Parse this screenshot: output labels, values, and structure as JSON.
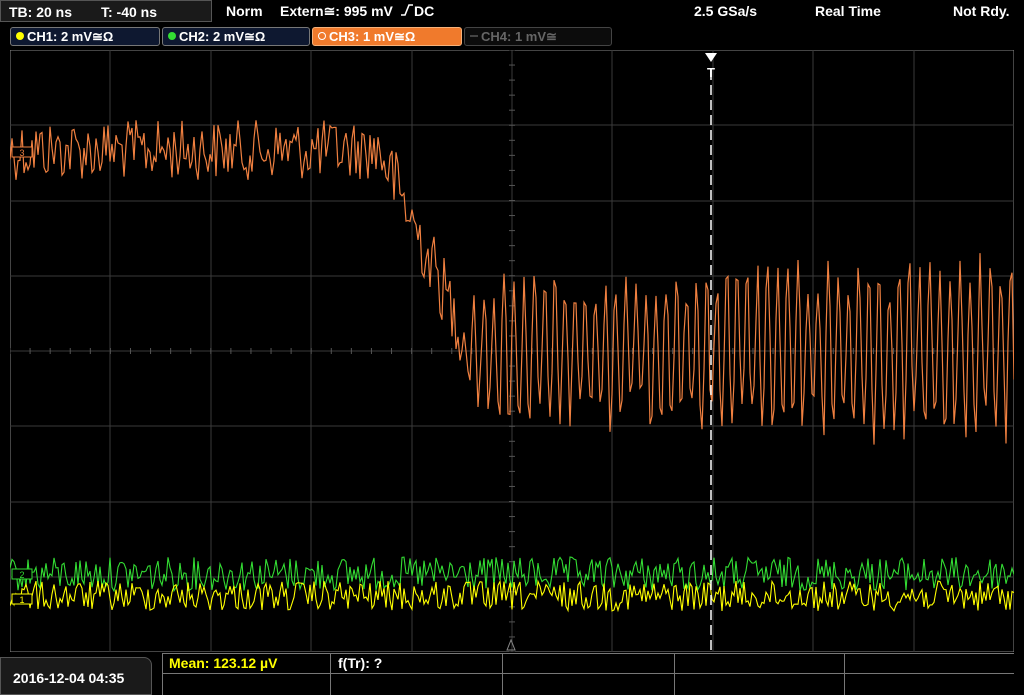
{
  "header": {
    "timebase": "TB: 20 ns",
    "trigger_time": "T: -40 ns",
    "trigger_mode": "Norm",
    "trigger_source": "Extern≅: 995 mV",
    "trigger_slope": "DC",
    "sample_rate": "2.5 GSa/s",
    "acq_mode": "Real Time",
    "status": "Not Rdy."
  },
  "channels": [
    {
      "label": "CH1: 2 mV≅Ω",
      "color": "#ffff00",
      "state": "on"
    },
    {
      "label": "CH2: 2 mV≅Ω",
      "color": "#33dd33",
      "state": "on"
    },
    {
      "label": "CH3: 1 mV≅Ω",
      "color": "#ff8c42",
      "state": "active"
    },
    {
      "label": "CH4: 1 mV≅",
      "color": "#666666",
      "state": "off"
    }
  ],
  "waveform_markers": {
    "ch1": "1",
    "ch2": "2",
    "ch3": "3",
    "trigger": "T"
  },
  "measurements": {
    "mean": "Mean: 123.12 µV",
    "ftr": "f(Tr): ?"
  },
  "footer": {
    "datetime": "2016-12-04 04:35"
  },
  "colors": {
    "ch1": "#ffff00",
    "ch2": "#33dd33",
    "ch3": "#f08040",
    "grid": "#3a3a3a",
    "mean_text": "#ffff00"
  }
}
